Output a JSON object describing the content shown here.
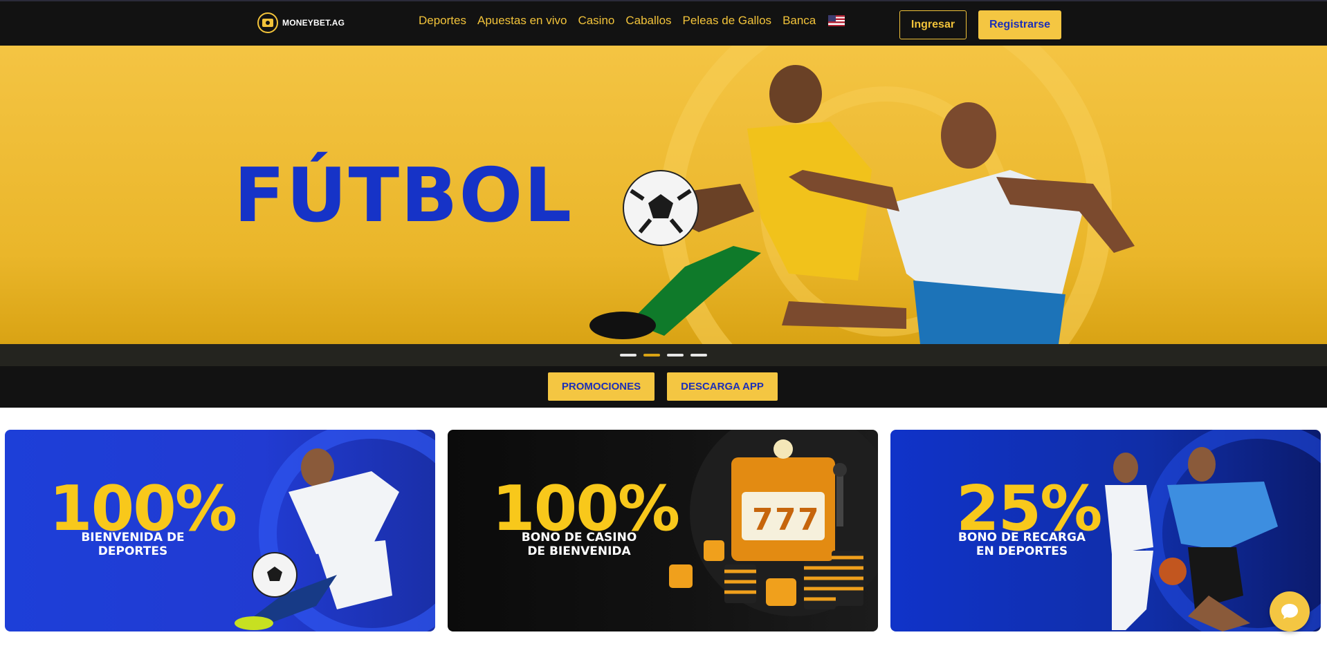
{
  "brand": {
    "name": "MONEYBET.AG"
  },
  "nav": {
    "items": [
      "Deportes",
      "Apuestas en vivo",
      "Casino",
      "Caballos",
      "Peleas de Gallos",
      "Banca"
    ],
    "language_icon": "us-flag-icon"
  },
  "auth": {
    "login_label": "Ingresar",
    "register_label": "Registrarse"
  },
  "hero": {
    "title": "FÚTBOL",
    "slides_total": 4,
    "active_slide": 2
  },
  "actions": {
    "promotions_label": "PROMOCIONES",
    "download_label": "DESCARGA APP"
  },
  "promos": [
    {
      "percent": "100%",
      "line1": "BIENVENIDA DE DEPORTES",
      "line2": ""
    },
    {
      "percent": "100%",
      "line1": "BONO DE CASINO",
      "line2": "DE BIENVENIDA"
    },
    {
      "percent": "25%",
      "line1": "BONO DE RECARGA",
      "line2": "EN DEPORTES"
    }
  ],
  "chat": {
    "icon": "chat-bubble-icon"
  },
  "colors": {
    "accent": "#f4c642",
    "brand_blue": "#1633c7",
    "topbar": "#121212"
  }
}
